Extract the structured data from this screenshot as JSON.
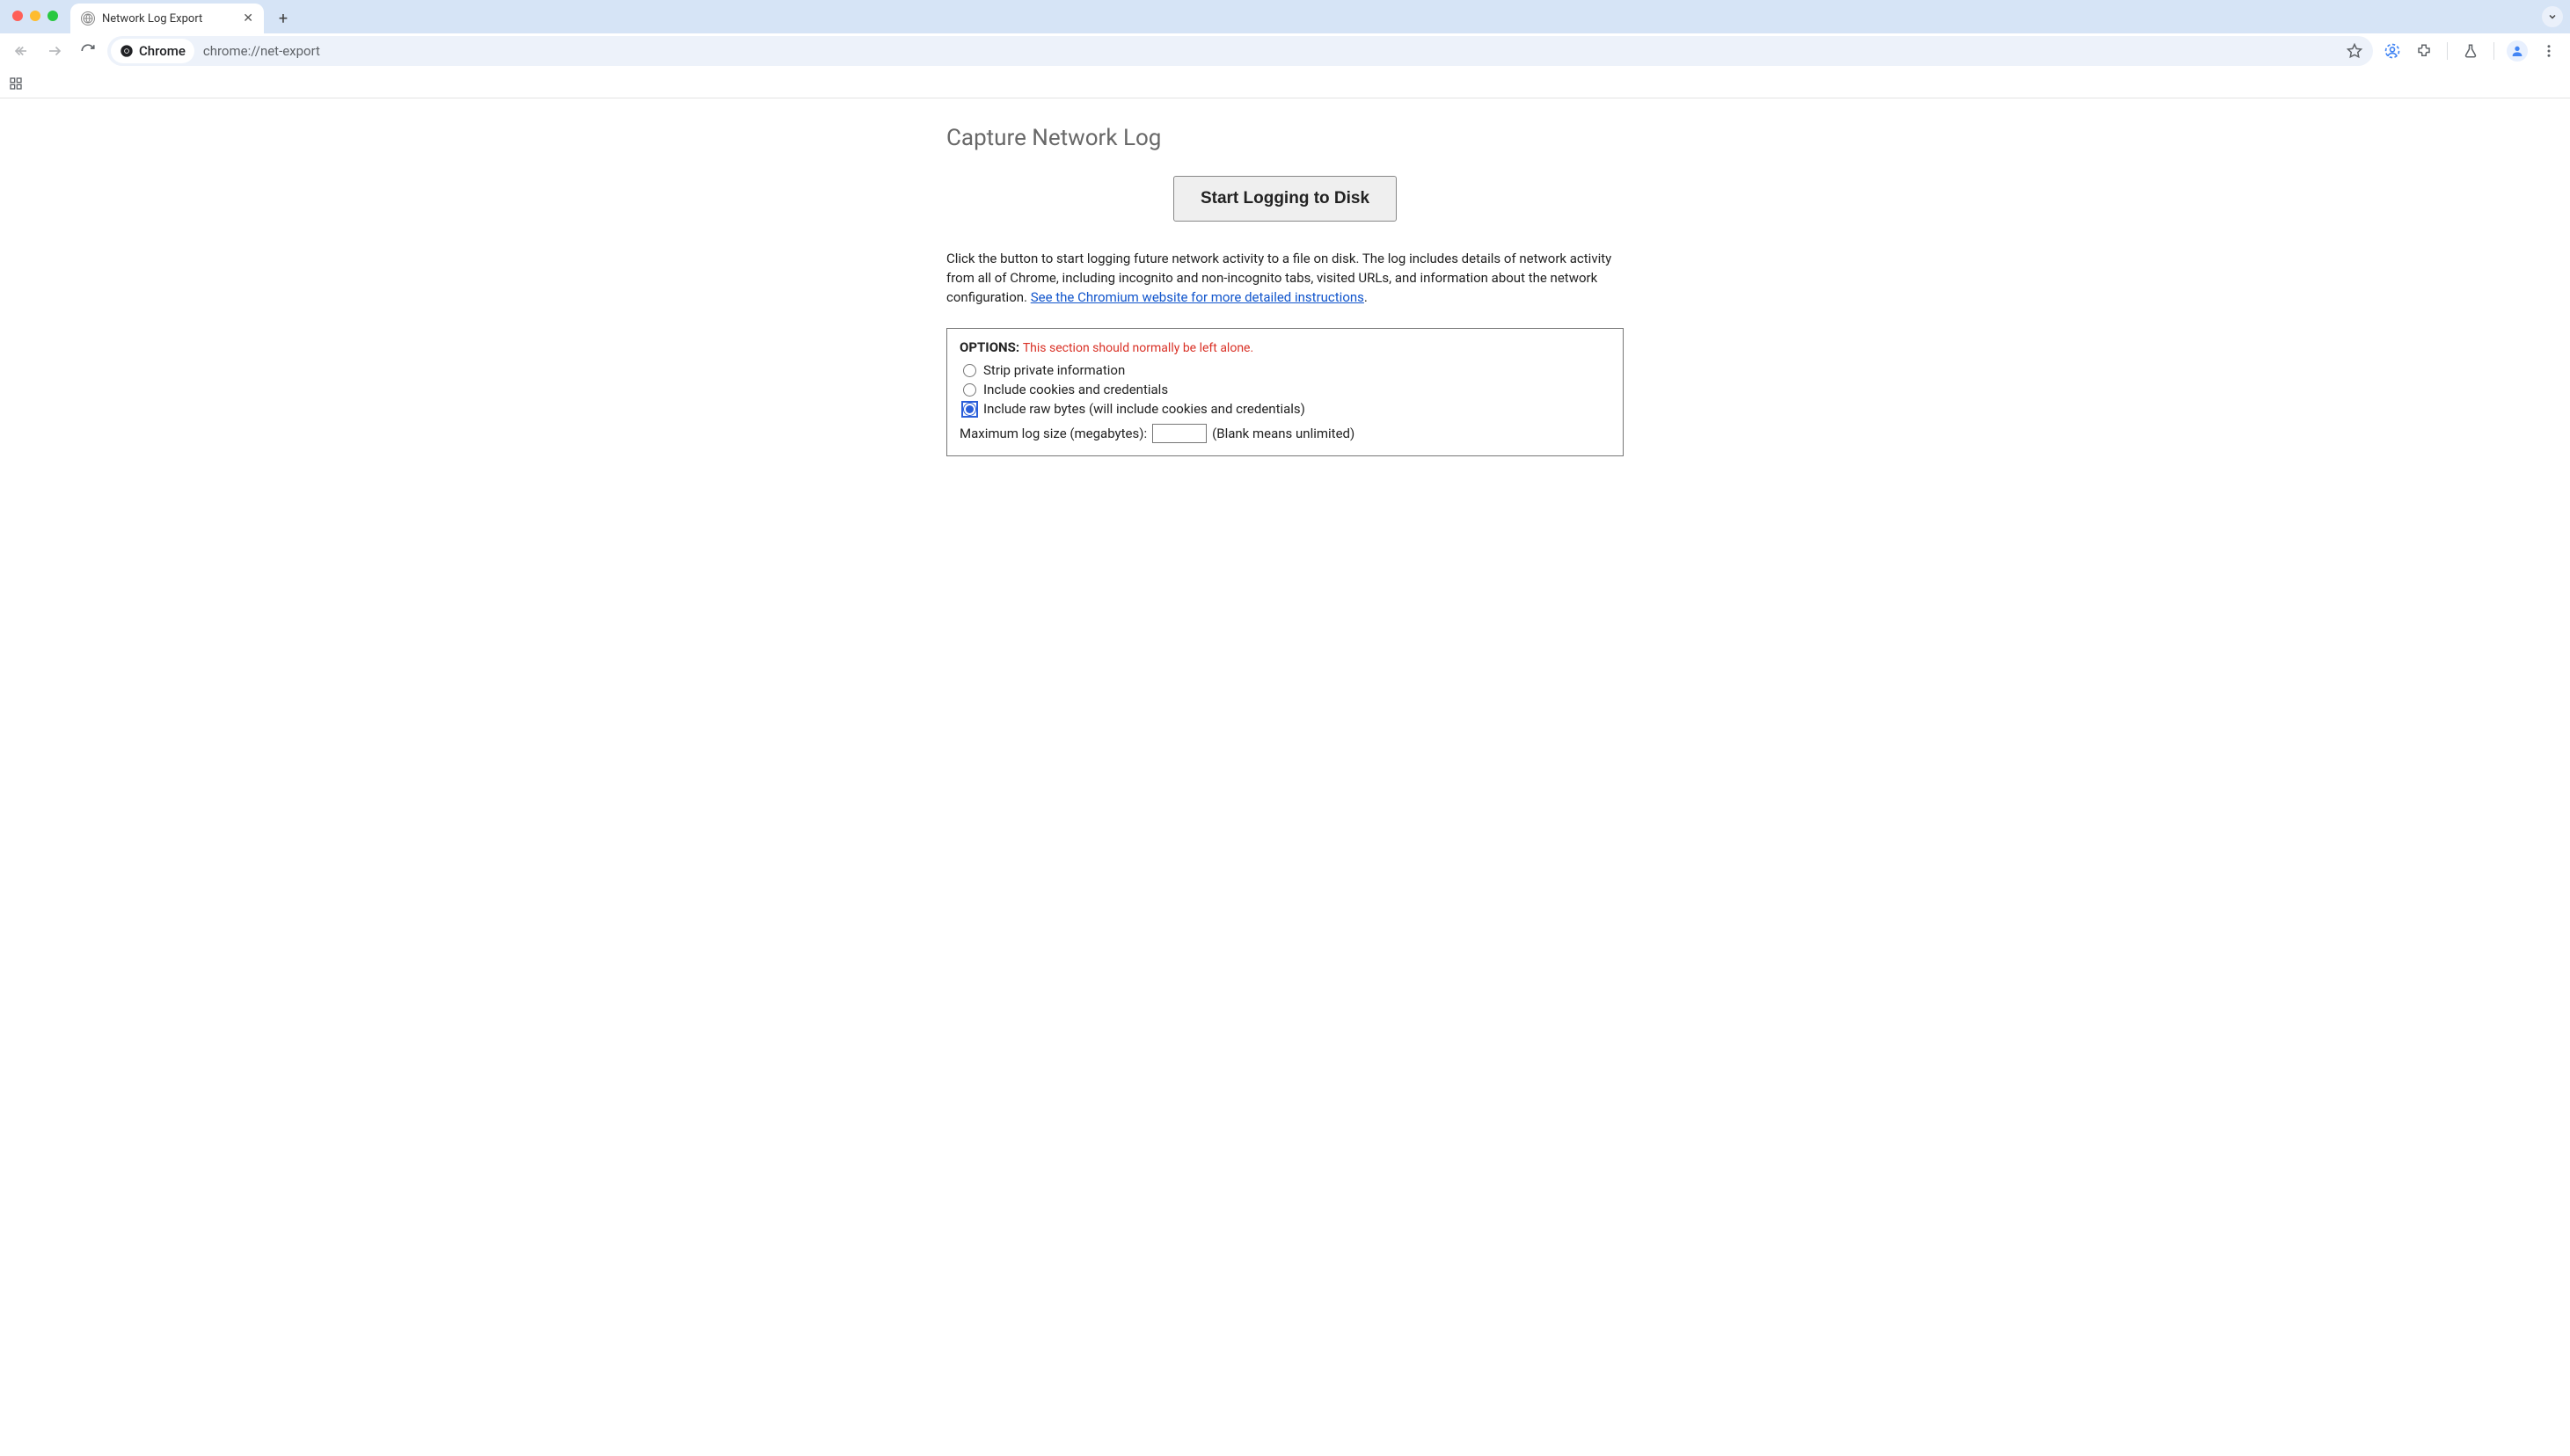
{
  "browser": {
    "tab_title": "Network Log Export",
    "omnibox": {
      "chip_label": "Chrome",
      "url_display": "chrome://net-export"
    }
  },
  "page": {
    "title": "Capture Network Log",
    "start_button": "Start Logging to Disk",
    "description_1": "Click the button to start logging future network activity to a file on disk. The log includes details of network activity from all of Chrome, including incognito and non-incognito tabs, visited URLs, and information about the network configuration. ",
    "link_text": "See the Chromium website for more detailed instructions",
    "description_end": ".",
    "options": {
      "label": "OPTIONS:",
      "warning": "This section should normally be left alone.",
      "radios": [
        {
          "label": "Strip private information",
          "selected": false
        },
        {
          "label": "Include cookies and credentials",
          "selected": false
        },
        {
          "label": "Include raw bytes (will include cookies and credentials)",
          "selected": true
        }
      ],
      "max_size_label": "Maximum log size (megabytes):",
      "max_size_value": "",
      "max_size_hint": "(Blank means unlimited)"
    }
  }
}
